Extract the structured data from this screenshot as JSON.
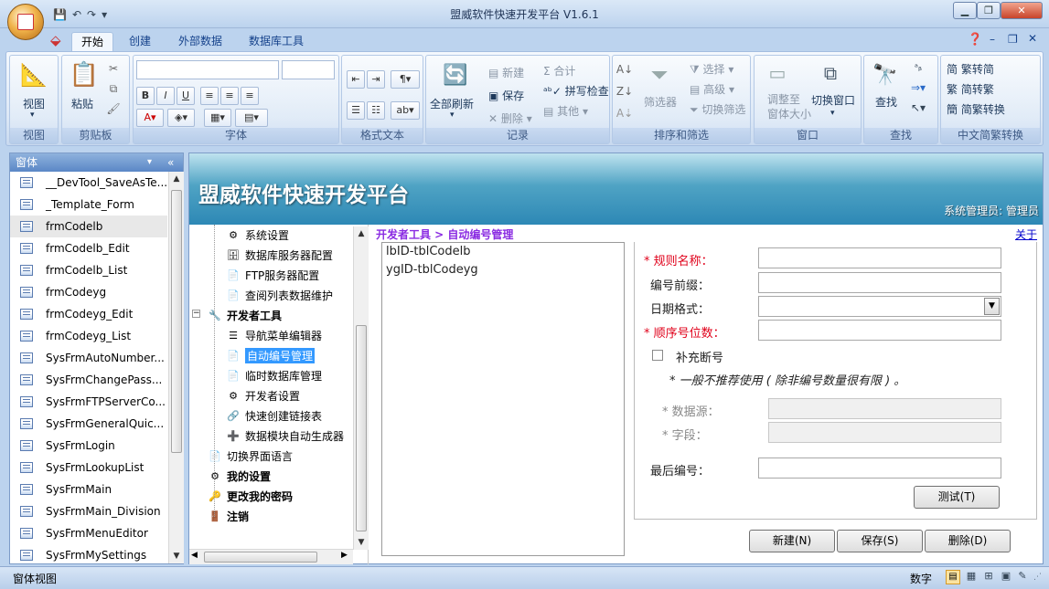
{
  "window": {
    "title": "盟威软件快速开发平台 V1.6.1",
    "controls": [
      "min-icon",
      "restore-icon",
      "close-icon"
    ]
  },
  "quick_access": {
    "save_icon": "save-icon",
    "undo_icon": "undo-icon",
    "redo_icon": "redo-icon",
    "custom_icon": "customize-icon"
  },
  "tabs": [
    {
      "label": "开始",
      "active": true
    },
    {
      "label": "创建",
      "active": false
    },
    {
      "label": "外部数据",
      "active": false
    },
    {
      "label": "数据库工具",
      "active": false
    }
  ],
  "ribbon": {
    "groups": {
      "view": {
        "label": "视图",
        "button": "视图"
      },
      "clipboard": {
        "label": "剪贴板",
        "paste": "粘贴"
      },
      "font": {
        "label": "字体"
      },
      "rich_text": {
        "label": "格式文本"
      },
      "records": {
        "label": "记录",
        "refresh": "全部刷新",
        "new": "新建",
        "save": "保存",
        "delete": "删除",
        "totals": "合计",
        "spelling": "拼写检查",
        "more": "其他"
      },
      "sort_filter": {
        "label": "排序和筛选",
        "filter": "筛选器",
        "selection": "选择",
        "advanced": "高级",
        "toggle": "切换筛选"
      },
      "window": {
        "label": "窗口",
        "fit": "调整至\n窗体大小",
        "switch": "切换窗口"
      },
      "find": {
        "label": "查找",
        "find": "查找"
      },
      "chinese": {
        "label": "中文简繁转换",
        "to_simplified": "繁转简",
        "to_traditional": "简转繁",
        "convert": "简繁转换"
      }
    }
  },
  "nav_pane": {
    "header": "窗体",
    "items": [
      "__DevTool_SaveAsTe...",
      "_Template_Form",
      "frmCodelb",
      "frmCodelb_Edit",
      "frmCodelb_List",
      "frmCodeyg",
      "frmCodeyg_Edit",
      "frmCodeyg_List",
      "SysFrmAutoNumber...",
      "SysFrmChangePass...",
      "SysFrmFTPServerCo...",
      "SysFrmGeneralQuic...",
      "SysFrmLogin",
      "SysFrmLookupList",
      "SysFrmMain",
      "SysFrmMain_Division",
      "SysFrmMenuEditor",
      "SysFrmMySettings"
    ],
    "selected_index": 2
  },
  "main": {
    "banner_title": "盟威软件快速开发平台",
    "user_label": "系统管理员: 管理员",
    "breadcrumb": "开发者工具 > 自动编号管理",
    "about_link": "关于",
    "tree": [
      {
        "label": "系统设置",
        "bold": false
      },
      {
        "label": "数据库服务器配置",
        "bold": false
      },
      {
        "label": "FTP服务器配置",
        "bold": false
      },
      {
        "label": "查阅列表数据维护",
        "bold": false
      },
      {
        "label": "开发者工具",
        "bold": true
      },
      {
        "label": "导航菜单编辑器",
        "bold": false
      },
      {
        "label": "自动编号管理",
        "bold": false,
        "selected": true
      },
      {
        "label": "临时数据库管理",
        "bold": false
      },
      {
        "label": "开发者设置",
        "bold": false
      },
      {
        "label": "快速创建链接表",
        "bold": false
      },
      {
        "label": "数据模块自动生成器",
        "bold": false
      },
      {
        "label": "切换界面语言",
        "bold": false
      },
      {
        "label": "我的设置",
        "bold": true
      },
      {
        "label": "更改我的密码",
        "bold": true
      },
      {
        "label": "注销",
        "bold": true
      }
    ],
    "id_list": [
      "lbID-tblCodelb",
      "ygID-tblCodeyg"
    ],
    "form": {
      "rule_name_label": "* 规则名称：",
      "prefix_label": "编号前缀：",
      "date_format_label": "日期格式：",
      "seq_digits_label": "* 顺序号位数：",
      "fill_gap_label": "补充断号",
      "fill_gap_checked": false,
      "warning": "* 一般不推荐使用 ( 除非编号数量很有限 ) 。",
      "datasource_label": "* 数据源：",
      "field_label": "* 字段：",
      "last_number_label": "最后编号：",
      "rule_name_value": "",
      "prefix_value": "",
      "date_format_value": "",
      "seq_digits_value": "",
      "last_number_value": "",
      "test_button": "测试(T)",
      "new_button": "新建(N)",
      "save_button": "保存(S)",
      "delete_button": "删除(D)"
    }
  },
  "status": {
    "left": "窗体视图",
    "numlock": "数字"
  }
}
